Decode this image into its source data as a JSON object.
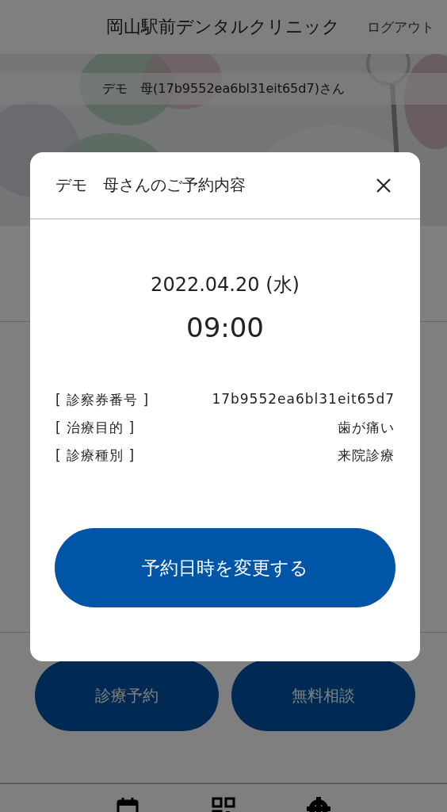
{
  "header": {
    "title": "岡山駅前デンタルクリニック",
    "logout": "ログアウト"
  },
  "hero": {
    "patient_name": "デモ　母(17b9552ea6bl31eit65d7)さん"
  },
  "actions": [
    "診療予約",
    "無料相談"
  ],
  "modal": {
    "title": "デモ　母さんのご予約内容",
    "date": "2022.04.20 (水)",
    "time": "09:00",
    "details": [
      {
        "label": "[ 診察券番号 ]",
        "value": "17b9552ea6bl31eit65d7"
      },
      {
        "label": "[ 治療目的 ]",
        "value": "歯が痛い"
      },
      {
        "label": "[ 診療種別 ]",
        "value": "来院診療"
      }
    ],
    "button": "予約日時を変更する"
  }
}
